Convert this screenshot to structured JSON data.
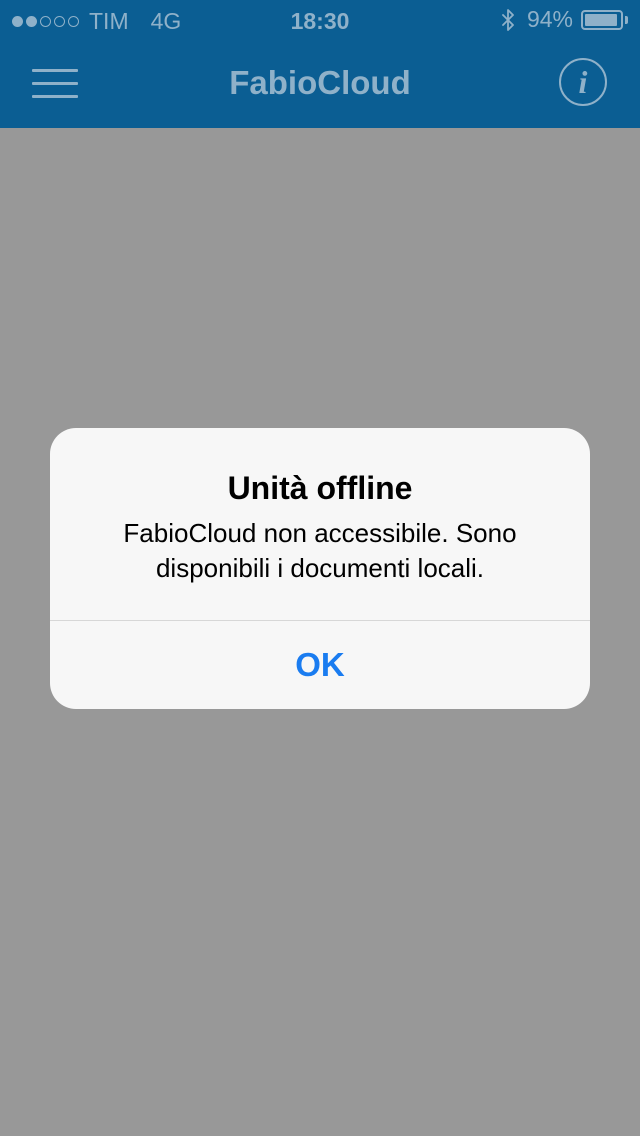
{
  "status_bar": {
    "signal_strength": "2 of 5",
    "carrier": "TIM",
    "network": "4G",
    "time": "18:30",
    "bluetooth_icon": "bluetooth-icon",
    "battery_percent": "94%",
    "battery_level": 0.94
  },
  "nav_bar": {
    "menu_icon": "hamburger-menu-icon",
    "title": "FabioCloud",
    "info_icon": "info-icon",
    "info_glyph": "i"
  },
  "alert": {
    "title": "Unità offline",
    "message": "FabioCloud non accessibile. Sono disponibili i documenti locali.",
    "ok_label": "OK"
  },
  "colors": {
    "nav_background": "#0b5e93",
    "nav_foreground": "#8fb1c9",
    "dimmed_background": "#989898",
    "alert_background": "#f7f7f7",
    "alert_button": "#1a7cf0"
  }
}
